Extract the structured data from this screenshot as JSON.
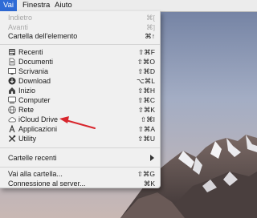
{
  "menubar": {
    "items": [
      {
        "label": "Vai",
        "active": true
      },
      {
        "label": "Finestra",
        "active": false
      },
      {
        "label": "Aiuto",
        "active": false
      }
    ]
  },
  "menu": {
    "back": {
      "label": "Indietro",
      "shortcut": "⌘["
    },
    "forward": {
      "label": "Avanti",
      "shortcut": "⌘]"
    },
    "enclosing": {
      "label": "Cartella dell'elemento",
      "shortcut": "⌘↑"
    },
    "places": [
      {
        "label": "Recenti",
        "shortcut": "⇧⌘F",
        "icon": "recents-icon"
      },
      {
        "label": "Documenti",
        "shortcut": "⇧⌘O",
        "icon": "documents-icon"
      },
      {
        "label": "Scrivania",
        "shortcut": "⇧⌘D",
        "icon": "desktop-icon"
      },
      {
        "label": "Download",
        "shortcut": "⌥⌘L",
        "icon": "downloads-icon"
      },
      {
        "label": "Inizio",
        "shortcut": "⇧⌘H",
        "icon": "home-icon"
      },
      {
        "label": "Computer",
        "shortcut": "⇧⌘C",
        "icon": "computer-icon"
      },
      {
        "label": "Rete",
        "shortcut": "⇧⌘K",
        "icon": "network-icon"
      },
      {
        "label": "iCloud Drive",
        "shortcut": "⇧⌘I",
        "icon": "icloud-icon"
      },
      {
        "label": "Applicazioni",
        "shortcut": "⇧⌘A",
        "icon": "applications-icon"
      },
      {
        "label": "Utility",
        "shortcut": "⇧⌘U",
        "icon": "utilities-icon"
      }
    ],
    "recent_folders": {
      "label": "Cartelle recenti"
    },
    "go_to_folder": {
      "label": "Vai alla cartella...",
      "shortcut": "⇧⌘G"
    },
    "connect_server": {
      "label": "Connessione al server...",
      "shortcut": "⌘K"
    }
  },
  "colors": {
    "menubar_active": "#2f6bd6",
    "annotation_arrow": "#d8262d"
  }
}
